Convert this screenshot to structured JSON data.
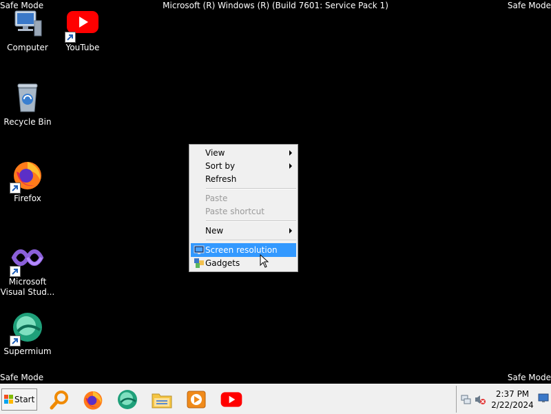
{
  "banner": {
    "safe_mode": "Safe Mode",
    "build": "Microsoft (R) Windows (R) (Build 7601: Service Pack 1)"
  },
  "desktop_icons": [
    {
      "label": "Computer",
      "icon": "computer-icon"
    },
    {
      "label": "YouTube",
      "icon": "youtube-icon"
    },
    {
      "label": "Recycle Bin",
      "icon": "recycle-bin-icon"
    },
    {
      "label": "Firefox",
      "icon": "firefox-icon"
    },
    {
      "label": "Microsoft Visual Stud...",
      "label_lines": [
        "Microsoft",
        "Visual Stud..."
      ],
      "icon": "visual-studio-icon"
    },
    {
      "label": "Supermium",
      "icon": "supermium-icon"
    }
  ],
  "context_menu": {
    "items": [
      {
        "label": "View",
        "submenu": true,
        "enabled": true
      },
      {
        "label": "Sort by",
        "submenu": true,
        "enabled": true
      },
      {
        "label": "Refresh",
        "submenu": false,
        "enabled": true
      },
      {
        "label": "Paste",
        "submenu": false,
        "enabled": false
      },
      {
        "label": "Paste shortcut",
        "submenu": false,
        "enabled": false
      },
      {
        "label": "New",
        "submenu": true,
        "enabled": true
      },
      {
        "label": "Screen resolution",
        "submenu": false,
        "enabled": true,
        "highlighted": true,
        "icon": "display-icon"
      },
      {
        "label": "Gadgets",
        "submenu": false,
        "enabled": true,
        "icon": "gadgets-icon"
      }
    ]
  },
  "taskbar": {
    "start_label": "Start",
    "pinned": [
      "search-magnifier-icon",
      "firefox-icon",
      "supermium-icon",
      "file-explorer-icon",
      "media-player-icon",
      "youtube-icon"
    ],
    "clock_time": "2:37 PM",
    "clock_date": "2/22/2024"
  },
  "colors": {
    "desktop": "#000000",
    "menu_highlight": "#3399ff",
    "youtube_red": "#ff0000"
  }
}
